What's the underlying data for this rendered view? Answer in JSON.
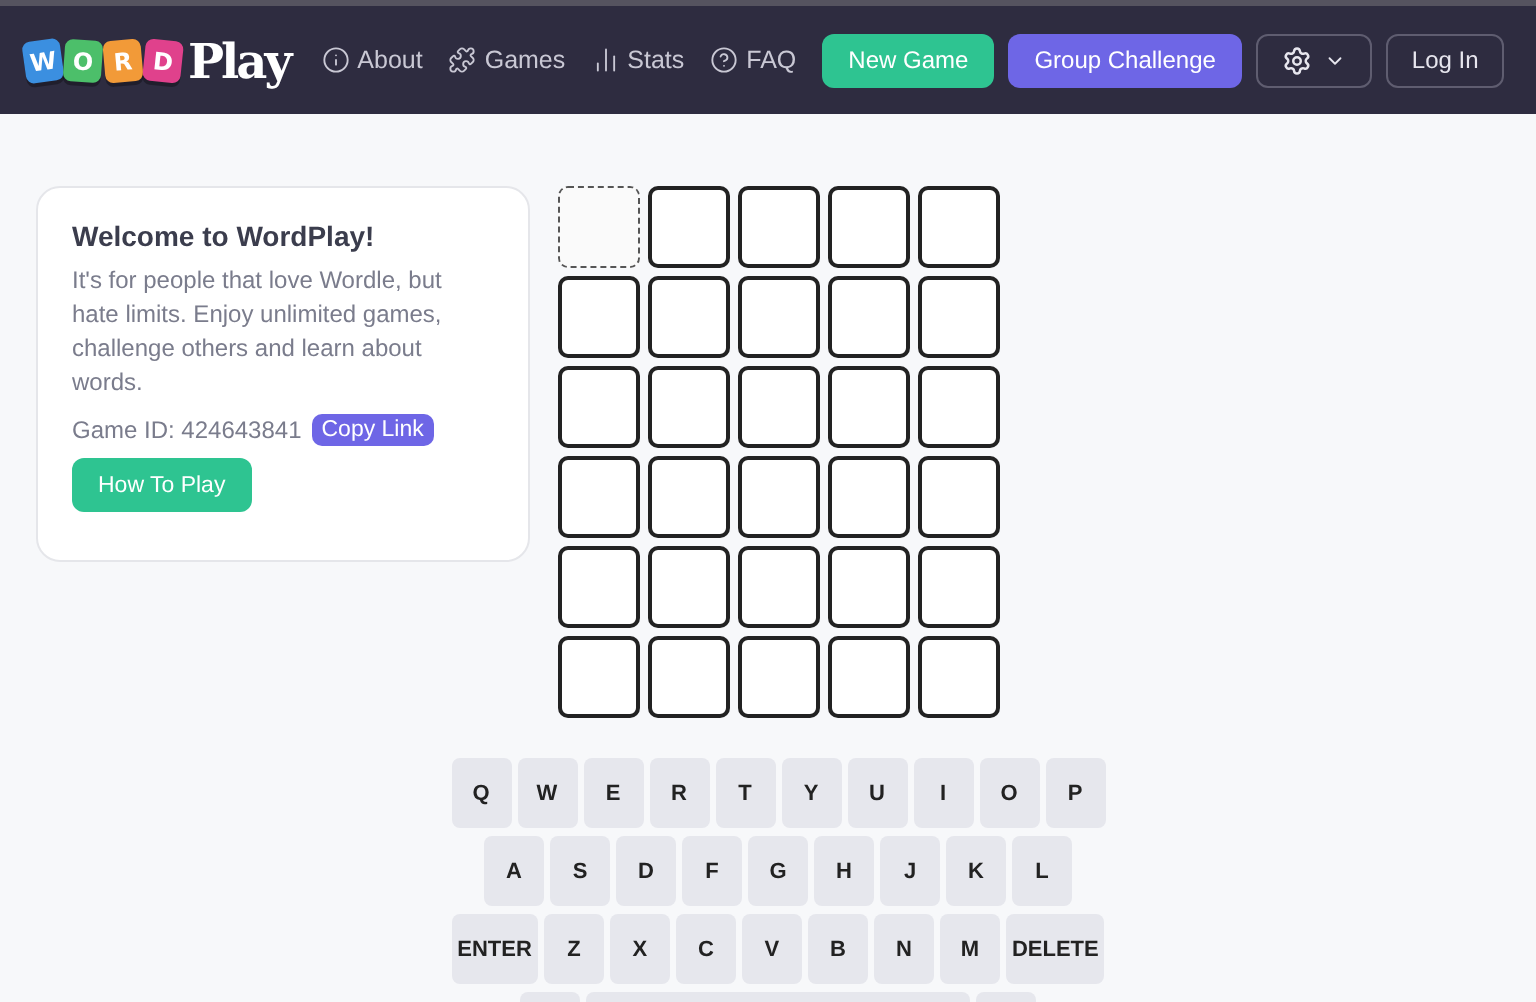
{
  "header": {
    "logo": {
      "tiles": [
        {
          "letter": "W",
          "color": "#3b8fe0"
        },
        {
          "letter": "O",
          "color": "#4cbf6a"
        },
        {
          "letter": "R",
          "color": "#f29a38"
        },
        {
          "letter": "D",
          "color": "#e0418c"
        }
      ],
      "word": "Play"
    },
    "nav": [
      {
        "label": "About",
        "kind": "info"
      },
      {
        "label": "Games",
        "kind": "puzzle"
      },
      {
        "label": "Stats",
        "kind": "chart"
      },
      {
        "label": "FAQ",
        "kind": "help"
      }
    ],
    "buttons": [
      {
        "label": "New Game",
        "kind": "green"
      },
      {
        "label": "Group Challenge",
        "kind": "purple"
      }
    ],
    "login": "Log In"
  },
  "welcome": {
    "title": "Welcome to WordPlay!",
    "text": "It's for people that love Wordle, but hate limits. Enjoy unlimited games, challenge others and learn about words.",
    "game_id": "Game ID: 424643841",
    "copy_link": "Copy Link",
    "how_to_play": "How To Play"
  },
  "board": [
    [
      {
        "selected": true
      },
      {
        "selected": false
      },
      {
        "selected": false
      },
      {
        "selected": false
      },
      {
        "selected": false
      }
    ],
    [
      {
        "selected": false
      },
      {
        "selected": false
      },
      {
        "selected": false
      },
      {
        "selected": false
      },
      {
        "selected": false
      }
    ],
    [
      {
        "selected": false
      },
      {
        "selected": false
      },
      {
        "selected": false
      },
      {
        "selected": false
      },
      {
        "selected": false
      }
    ],
    [
      {
        "selected": false
      },
      {
        "selected": false
      },
      {
        "selected": false
      },
      {
        "selected": false
      },
      {
        "selected": false
      }
    ],
    [
      {
        "selected": false
      },
      {
        "selected": false
      },
      {
        "selected": false
      },
      {
        "selected": false
      },
      {
        "selected": false
      }
    ],
    [
      {
        "selected": false
      },
      {
        "selected": false
      },
      {
        "selected": false
      },
      {
        "selected": false
      },
      {
        "selected": false
      }
    ]
  ],
  "keyboard": [
    [
      "Q",
      "W",
      "E",
      "R",
      "T",
      "Y",
      "U",
      "I",
      "O",
      "P"
    ],
    [
      "A",
      "S",
      "D",
      "F",
      "G",
      "H",
      "J",
      "K",
      "L"
    ],
    [
      "ENTER",
      "Z",
      "X",
      "C",
      "V",
      "B",
      "N",
      "M",
      "DELETE"
    ]
  ]
}
